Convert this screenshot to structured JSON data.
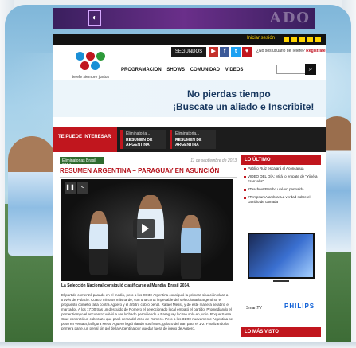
{
  "top_banner": {
    "logo_glyph": "◐",
    "ad_text": "ADO"
  },
  "topbar": {
    "login_text": "Iniciar sesión"
  },
  "header": {
    "logo_text": "telefe siempre juntos",
    "segundos_label": "SEGUNDOS",
    "social": [
      "▶",
      "f",
      "t",
      "♥"
    ],
    "user_prompt": "¿No sos usuario de Telefe?",
    "register_label": "Registrate"
  },
  "nav": {
    "items": [
      "PROGRAMACION",
      "SHOWS",
      "COMUNIDAD",
      "VIDEOS"
    ]
  },
  "promo": {
    "line1": "No pierdas tiempo",
    "line2": "¡Buscate un aliado e Inscribite!"
  },
  "interest": {
    "label": "TE PUEDE INTERESAR",
    "cards": [
      {
        "category": "Eliminatoria...",
        "title": "RESUMEN DE ARGENTINA"
      },
      {
        "category": "Eliminatoria...",
        "title": "RESUMEN DE ARGENTINA"
      }
    ]
  },
  "article": {
    "category": "Eliminatorias Brasil 2014",
    "date": "11 de septiembre de 2013",
    "headline": "RESUMEN ARGENTINA – PARAGUAY EN ASUNCIÓN",
    "caption": "La Selección Nacional consiguió clasificarse al Mundial Brasil 2014.",
    "body": "El partido comenzó pasado en el medio, pero a los 06:30 Argentina consiguió la primera situación clara a través de Pulacio. Cuatro minutos más tarde, con una corta impecable del seleccionado argentino, el propuesto cometió falta contra Agüero y el árbitro cobró penal. Rafael Messi, y de este manera se abrió el marcador. A los 17:00 tras un descuido de Romero el seleccionado local empató el partido. Promediando el primer tiempo el encuentro volvió a ser luchado permitiendo a Paraguay lucirse solo en junio. Roque Santa Cruz concretó un cabezazo que pasó cerca del arco de Romero. Pero a los 31:00 nuevamente Argentina se puso en ventaja, la figura Messi Agüero logró dando sus frutos, golazo del tran para el 1-2. Finalizando la primera parte, un penal sin gol de la Argentina por quedar fuera de juego de Agüero."
  },
  "lo_ultimo": {
    "title": "LO ÚLTIMO",
    "items": [
      "Pablito Ruiz escalará el Aconcagua",
      "VIDEO DEL DÍA: Mirá lo empate de \"Yiiné a Franzella\"",
      "#TeschnuFBetcho usé un pennalda",
      "#TempsumAlambra: La verdad sobre el cambio de camada"
    ]
  },
  "ad": {
    "brand": "PHILIPS",
    "product": "SmartTV"
  },
  "mas_visto": {
    "title": "LO MÁS VISTO"
  },
  "colors": {
    "telefe_red": "#c1161e",
    "telefe_blue": "#1a8fd6",
    "telefe_green": "#2e9a3a",
    "philips_blue": "#0b5ed7"
  }
}
